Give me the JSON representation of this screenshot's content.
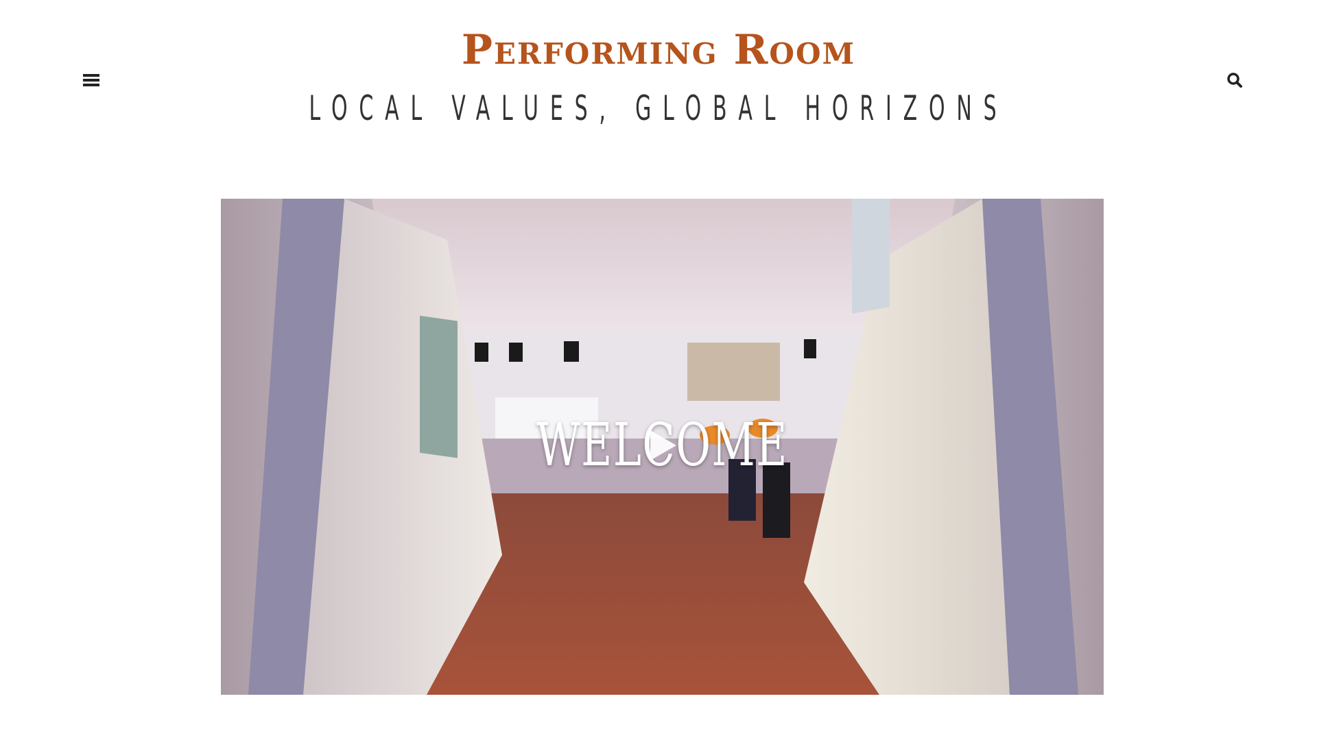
{
  "header": {
    "site_title": "Performing Room",
    "tagline": "LOCAL VALUES, GLOBAL HORIZONS",
    "title_color": "#b5541c",
    "menu_icon": "hamburger-menu-icon",
    "search_icon": "search-icon"
  },
  "hero": {
    "video_overlay_text": "WELCOME",
    "play_icon": "play-icon"
  }
}
